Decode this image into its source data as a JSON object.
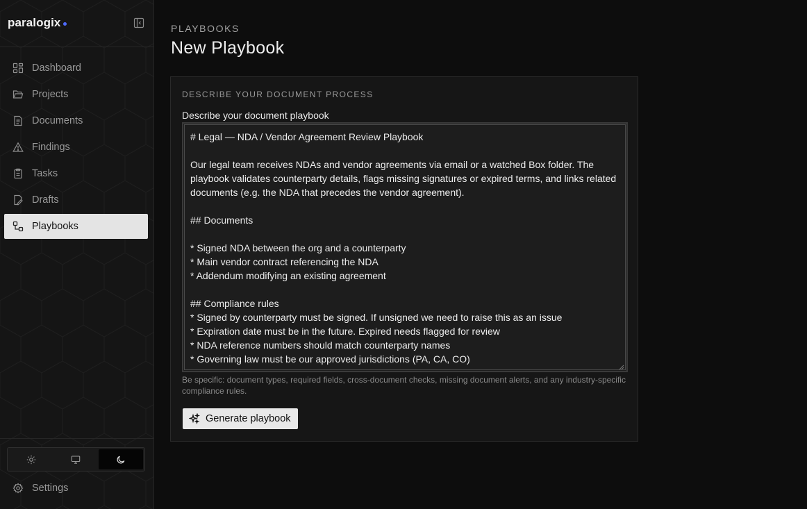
{
  "brand": {
    "name": "paralogix",
    "accent": "#4f6bff"
  },
  "sidebar": {
    "collapse_icon": "sidebar-collapse-icon",
    "items": [
      {
        "label": "Dashboard",
        "icon": "dashboard-icon",
        "active": false
      },
      {
        "label": "Projects",
        "icon": "folder-icon",
        "active": false
      },
      {
        "label": "Documents",
        "icon": "document-icon",
        "active": false
      },
      {
        "label": "Findings",
        "icon": "warning-triangle-icon",
        "active": false
      },
      {
        "label": "Tasks",
        "icon": "clipboard-icon",
        "active": false
      },
      {
        "label": "Drafts",
        "icon": "draft-file-icon",
        "active": false
      },
      {
        "label": "Playbooks",
        "icon": "workflow-icon",
        "active": true
      }
    ],
    "theme": {
      "options": [
        "light",
        "system",
        "dark"
      ],
      "selected": "dark"
    },
    "settings_label": "Settings"
  },
  "header": {
    "breadcrumb": "PLAYBOOKS",
    "title": "New Playbook"
  },
  "form": {
    "section_heading": "DESCRIBE YOUR DOCUMENT PROCESS",
    "field_label": "Describe your document playbook",
    "textarea_value": "# Legal — NDA / Vendor Agreement Review Playbook\n\nOur legal team receives NDAs and vendor agreements via email or a watched Box folder. The playbook validates counterparty details, flags missing signatures or expired terms, and links related documents (e.g. the NDA that precedes the vendor agreement).\n\n## Documents\n\n* Signed NDA between the org and a counterparty\n* Main vendor contract referencing the NDA\n* Addendum modifying an existing agreement\n\n## Compliance rules\n* Signed by counterparty must be signed. If unsigned we need to raise this as an issue\n* Expiration date must be in the future. Expired needs flagged for review\n* NDA reference numbers should match counterparty names\n* Governing law must be our approved jurisdictions (PA, CA, CO)",
    "hint": "Be specific: document types, required fields, cross-document checks, missing document alerts, and any industry-specific compliance rules.",
    "generate_label": "Generate playbook"
  }
}
